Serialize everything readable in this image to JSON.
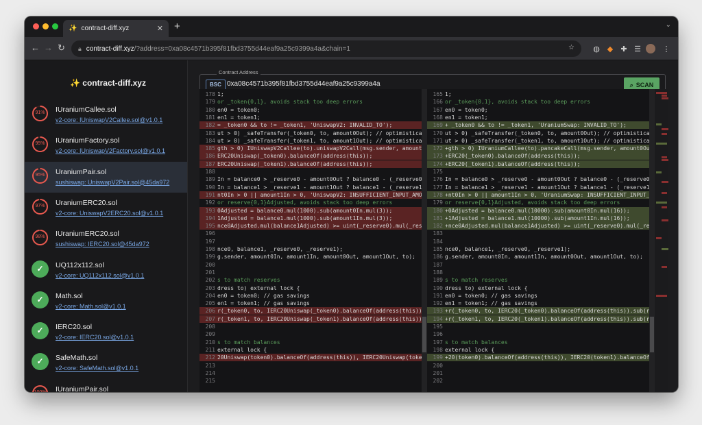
{
  "browser": {
    "tab_title": "contract-diff.xyz",
    "tab_icon": "sparkles",
    "url_host": "contract-diff.xyz",
    "url_path": "/?address=0xa08c4571b395f81fbd3755d44eaf9a25c9399a4a&chain=1"
  },
  "app": {
    "brand": "✨ contract-diff.xyz",
    "address_label": "Contract Address",
    "chain": "BSC",
    "address": "0xa08c4571b395f81fbd3755d44eaf9a25c9399a4a",
    "scan_label": "SCAN"
  },
  "colors": {
    "match_high": "#4dab5a",
    "match_low": "#ea5a50",
    "removed_bg": "#5a2323",
    "added_bg": "#3f4a2e"
  },
  "sidebar": {
    "items": [
      {
        "name": "IUraniumCallee.sol",
        "path": "v2-core: IUniswapV2Callee.sol@v1.0.1",
        "score": "91%",
        "percent": 91,
        "status": "diff",
        "active": false
      },
      {
        "name": "IUraniumFactory.sol",
        "path": "v2-core: IUniswapV2Factory.sol@v1.0.1",
        "score": "95%",
        "percent": 95,
        "status": "diff",
        "active": false
      },
      {
        "name": "UraniumPair.sol",
        "path": "sushiswap: UniswapV2Pair.sol@45da972",
        "score": "95%",
        "percent": 95,
        "status": "diff",
        "active": true
      },
      {
        "name": "UraniumERC20.sol",
        "path": "v2-core: UniswapV2ERC20.sol@v1.0.1",
        "score": "97%",
        "percent": 97,
        "status": "diff",
        "active": false
      },
      {
        "name": "IUraniumERC20.sol",
        "path": "sushiswap: IERC20.sol@45da972",
        "score": "98%",
        "percent": 98,
        "status": "diff",
        "active": false
      },
      {
        "name": "UQ112x112.sol",
        "path": "v2-core: UQ112x112.sol@v1.0.1",
        "score": "",
        "percent": 100,
        "status": "match",
        "active": false
      },
      {
        "name": "Math.sol",
        "path": "v2-core: Math.sol@v1.0.1",
        "score": "",
        "percent": 100,
        "status": "match",
        "active": false
      },
      {
        "name": "IERC20.sol",
        "path": "v2-core: IERC20.sol@v1.0.1",
        "score": "",
        "percent": 100,
        "status": "match",
        "active": false
      },
      {
        "name": "SafeMath.sol",
        "path": "v2-core: SafeMath.sol@v1.0.1",
        "score": "",
        "percent": 100,
        "status": "match",
        "active": false
      },
      {
        "name": "IUraniumPair.sol",
        "path": "v2-core: IUniswapV2Pair.sol@v1.0.1",
        "score": "100%",
        "percent": 100,
        "status": "diff",
        "active": false
      }
    ]
  },
  "diff": {
    "left": [
      {
        "n": "178",
        "t": "1;",
        "k": ""
      },
      {
        "n": "179",
        "t": "or _token{0,1}, avoids stack too deep errors",
        "k": "c"
      },
      {
        "n": "180",
        "t": "en0 = token0;",
        "k": ""
      },
      {
        "n": "181",
        "t": "en1 = token1;",
        "k": ""
      },
      {
        "n": "182",
        "t": "= _token0 && to != _token1, 'UniswapV2: INVALID_TO');",
        "k": "del"
      },
      {
        "n": "183",
        "t": "ut > 0) _safeTransfer(_token0, to, amount0Out); // optimistically tr",
        "k": ""
      },
      {
        "n": "184",
        "t": "ut > 0) _safeTransfer(_token1, to, amount1Out); // optimistically tr",
        "k": ""
      },
      {
        "n": "185",
        "t": "gth > 0) IUniswapV2Callee(to).uniswapV2Call(msg.sender, amount0Out, a",
        "k": "del"
      },
      {
        "n": "186",
        "t": "ERC20Uniswap(_token0).balanceOf(address(this));",
        "k": "del"
      },
      {
        "n": "187",
        "t": "ERC20Uniswap(_token1).balanceOf(address(this));",
        "k": "del"
      },
      {
        "n": "188",
        "t": "",
        "k": ""
      },
      {
        "n": "189",
        "t": "In = balance0 > _reserve0 - amount0Out ? balance0 - (_reserve0 - am",
        "k": ""
      },
      {
        "n": "190",
        "t": "In = balance1 > _reserve1 - amount1Out ? balance1 - (_reserve1 - am",
        "k": ""
      },
      {
        "n": "191",
        "t": "nt0In > 0 || amount1In > 0, 'UniswapV2: INSUFFICIENT_INPUT_AMOUNT');",
        "k": "del"
      },
      {
        "n": "192",
        "t": "or reserve{0,1}Adjusted, avoids stack too deep errors",
        "k": "c"
      },
      {
        "n": "193",
        "t": "0Adjusted = balance0.mul(1000).sub(amount0In.mul(3));",
        "k": "del"
      },
      {
        "n": "194",
        "t": "1Adjusted = balance1.mul(1000).sub(amount1In.mul(3));",
        "k": "del"
      },
      {
        "n": "195",
        "t": "nce0Adjusted.mul(balance1Adjusted) >= uint(_reserve0).mul(_reserve1",
        "k": "del"
      },
      {
        "n": "196",
        "t": "",
        "k": ""
      },
      {
        "n": "197",
        "t": "",
        "k": ""
      },
      {
        "n": "198",
        "t": "nce0, balance1, _reserve0, _reserve1);",
        "k": ""
      },
      {
        "n": "199",
        "t": "g.sender, amount0In, amount1In, amount0Out, amount1Out, to);",
        "k": ""
      },
      {
        "n": "200",
        "t": "",
        "k": ""
      },
      {
        "n": "201",
        "t": "",
        "k": ""
      },
      {
        "n": "202",
        "t": "s to match reserves",
        "k": "c"
      },
      {
        "n": "203",
        "t": "dress to) external lock {",
        "k": ""
      },
      {
        "n": "204",
        "t": "en0 = token0; // gas savings",
        "k": ""
      },
      {
        "n": "205",
        "t": "en1 = token1; // gas savings",
        "k": ""
      },
      {
        "n": "206",
        "t": "r(_token0, to, IERC20Uniswap(_token0).balanceOf(address(this)).sub(",
        "k": "del"
      },
      {
        "n": "207",
        "t": "r(_token1, to, IERC20Uniswap(_token1).balanceOf(address(this)).sub(",
        "k": "del"
      },
      {
        "n": "208",
        "t": "",
        "k": ""
      },
      {
        "n": "209",
        "t": "",
        "k": ""
      },
      {
        "n": "210",
        "t": "s to match balances",
        "k": "c"
      },
      {
        "n": "211",
        "t": "external lock {",
        "k": ""
      },
      {
        "n": "212",
        "t": "20Uniswap(token0).balanceOf(address(this)), IERC20Uniswap(token1).ba",
        "k": "del"
      },
      {
        "n": "213",
        "t": "",
        "k": ""
      },
      {
        "n": "214",
        "t": "",
        "k": ""
      },
      {
        "n": "215",
        "t": "",
        "k": ""
      }
    ],
    "right": [
      {
        "n": "165",
        "t": "1;",
        "k": ""
      },
      {
        "n": "166",
        "t": "or _token{0,1}, avoids stack too deep errors",
        "k": "c"
      },
      {
        "n": "167",
        "t": "en0 = token0;",
        "k": ""
      },
      {
        "n": "168",
        "t": "en1 = token1;",
        "k": ""
      },
      {
        "n": "169",
        "t": "+ _token0 && to != _token1, 'UraniumSwap: INVALID_TO');",
        "k": "add"
      },
      {
        "n": "170",
        "t": "ut > 0) _safeTransfer(_token0, to, amount0Out); // optimistically tr",
        "k": ""
      },
      {
        "n": "171",
        "t": "ut > 0) _safeTransfer(_token1, to, amount1Out); // optimistically tr",
        "k": ""
      },
      {
        "n": "172",
        "t": "+gth > 0) IUraniumCallee(to).pancakeCall(msg.sender, amount0Out, amo",
        "k": "add"
      },
      {
        "n": "173",
        "t": "+ERC20(_token0).balanceOf(address(this));",
        "k": "add"
      },
      {
        "n": "174",
        "t": "+ERC20(_token1).balanceOf(address(this));",
        "k": "add"
      },
      {
        "n": "175",
        "t": "",
        "k": ""
      },
      {
        "n": "176",
        "t": "In = balance0 > _reserve0 - amount0Out ? balance0 - (_reserve0 - am",
        "k": ""
      },
      {
        "n": "177",
        "t": "In = balance1 > _reserve1 - amount1Out ? balance1 - (_reserve1 - am",
        "k": ""
      },
      {
        "n": "178",
        "t": "+nt0In > 0 || amount1In > 0, 'UraniumSwap: INSUFFICIENT_INPUT_AMOUNT",
        "k": "add"
      },
      {
        "n": "179",
        "t": "or reserve{0,1}Adjusted, avoids stack too deep errors",
        "k": "c"
      },
      {
        "n": "180",
        "t": "+0Adjusted = balance0.mul(10000).sub(amount0In.mul(16));",
        "k": "add"
      },
      {
        "n": "181",
        "t": "+1Adjusted = balance1.mul(10000).sub(amount1In.mul(16));",
        "k": "add"
      },
      {
        "n": "182",
        "t": "+nce0Adjusted.mul(balance1Adjusted) >= uint(_reserve0).mul(_reserve1",
        "k": "add"
      },
      {
        "n": "183",
        "t": "",
        "k": ""
      },
      {
        "n": "184",
        "t": "",
        "k": ""
      },
      {
        "n": "185",
        "t": "nce0, balance1, _reserve0, _reserve1);",
        "k": ""
      },
      {
        "n": "186",
        "t": "g.sender, amount0In, amount1In, amount0Out, amount1Out, to);",
        "k": ""
      },
      {
        "n": "187",
        "t": "",
        "k": ""
      },
      {
        "n": "188",
        "t": "",
        "k": ""
      },
      {
        "n": "189",
        "t": "s to match reserves",
        "k": "c"
      },
      {
        "n": "190",
        "t": "dress to) external lock {",
        "k": ""
      },
      {
        "n": "191",
        "t": "en0 = token0; // gas savings",
        "k": ""
      },
      {
        "n": "192",
        "t": "en1 = token1; // gas savings",
        "k": ""
      },
      {
        "n": "193",
        "t": "+r(_token0, to, IERC20(_token0).balanceOf(address(this)).sub(reserve",
        "k": "add"
      },
      {
        "n": "194",
        "t": "+r(_token1, to, IERC20(_token1).balanceOf(address(this)).sub(reserve",
        "k": "add"
      },
      {
        "n": "195",
        "t": "",
        "k": ""
      },
      {
        "n": "196",
        "t": "",
        "k": ""
      },
      {
        "n": "197",
        "t": "s to match balances",
        "k": "c"
      },
      {
        "n": "198",
        "t": "external lock {",
        "k": ""
      },
      {
        "n": "199",
        "t": "+20(token0).balanceOf(address(this)), IERC20(token1).balanceOf(addre",
        "k": "add"
      },
      {
        "n": "200",
        "t": "",
        "k": ""
      },
      {
        "n": "201",
        "t": "",
        "k": ""
      },
      {
        "n": "202",
        "t": "",
        "k": ""
      }
    ]
  }
}
